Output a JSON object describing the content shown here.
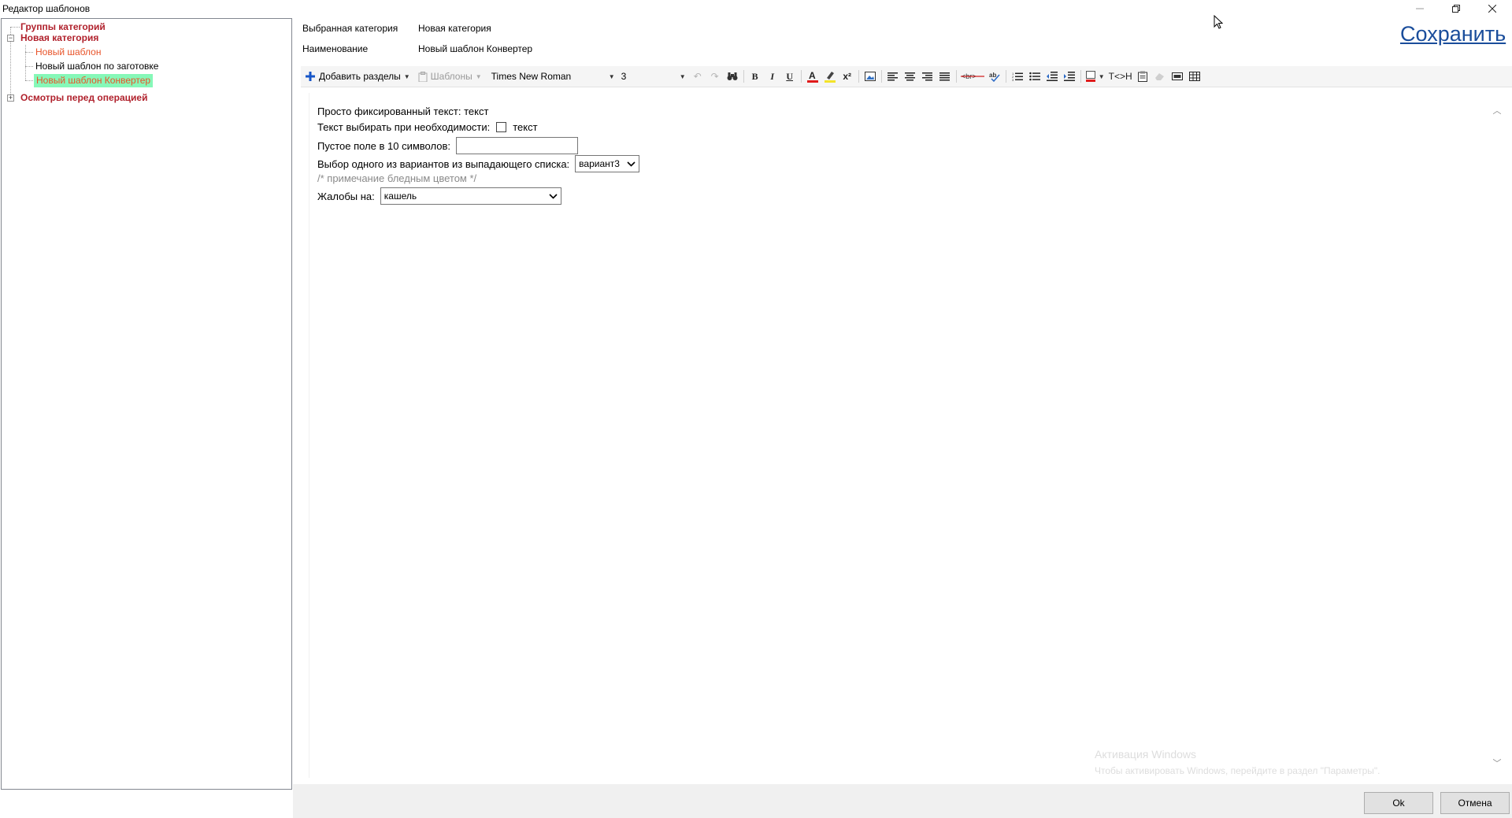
{
  "window": {
    "title": "Редактор шаблонов",
    "minimize_icon": "minimize-icon",
    "restore_icon": "restore-icon",
    "close_icon": "close-icon"
  },
  "tree": {
    "root": "Группы категорий",
    "category": "Новая категория",
    "templates": [
      "Новый шаблон",
      "Новый шаблон по заготовке",
      "Новый шаблон Конвертер"
    ],
    "other_group": "Осмотры перед операцией"
  },
  "header": {
    "selected_category_label": "Выбранная категория",
    "selected_category_value": "Новая категория",
    "name_label": "Наименование",
    "name_value": "Новый шаблон Конвертер",
    "save_link": "Сохранить"
  },
  "toolbar": {
    "add_sections": "Добавить разделы",
    "templates": "Шаблоны",
    "font_name": "Times New Roman",
    "font_size": "3",
    "html_toggle": "T<>H"
  },
  "editor": {
    "line1": "Просто фиксированный текст: текст",
    "line2_label": "Текст выбирать при необходимости:",
    "line2_check_text": "текст",
    "line3_label": "Пустое поле в 10 символов:",
    "line4_label": "Выбор одного из вариантов из выпадающего списка:",
    "line4_value": "вариант3",
    "line5_note": "/* примечание бледным цветом */",
    "line6_label": "Жалобы на:",
    "line6_value": "кашель"
  },
  "watermark": {
    "line1": "Активация Windows",
    "line2": "Чтобы активировать Windows, перейдите в раздел \"Параметры\"."
  },
  "buttons": {
    "ok": "Ok",
    "cancel": "Отмена"
  }
}
